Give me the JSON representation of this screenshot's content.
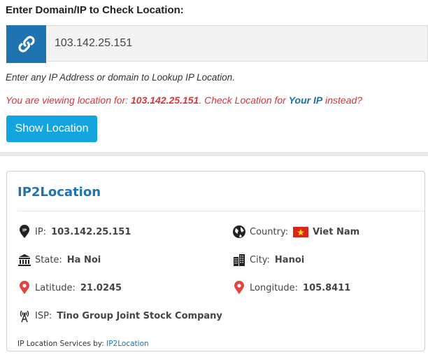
{
  "form": {
    "heading": "Enter Domain/IP to Check Location:",
    "input_value": "103.142.25.151",
    "hint": "Enter any IP Address or domain to Lookup IP Location.",
    "viewing_prefix": "You are viewing location for: ",
    "viewing_ip": "103.142.25.151",
    "viewing_middle": ". Check Location for ",
    "your_ip_link": "Your IP",
    "viewing_suffix": " instead?",
    "button_label": "Show Location"
  },
  "result": {
    "title": "IP2Location",
    "ip_label": "IP:",
    "ip_value": "103.142.25.151",
    "country_label": "Country:",
    "country_value": "Viet Nam",
    "state_label": "State:",
    "state_value": "Ha Noi",
    "city_label": "City:",
    "city_value": "Hanoi",
    "latitude_label": "Latitude:",
    "latitude_value": "21.0245",
    "longitude_label": "Longitude:",
    "longitude_value": "105.8411",
    "isp_label": "ISP:",
    "isp_value": "Tino Group Joint Stock Company",
    "footer_text": "IP Location Services by: ",
    "footer_link": "IP2Location"
  },
  "colors": {
    "addon_blue": "#1f73b0",
    "button_blue": "#12a5e0",
    "warning_red": "#d9343a",
    "marker_red": "#e0463c"
  },
  "icons": [
    "link-icon",
    "ip-pin-icon",
    "globe-icon",
    "flag-vietnam-icon",
    "building-icon",
    "city-icon",
    "map-marker-icon",
    "antenna-icon"
  ]
}
